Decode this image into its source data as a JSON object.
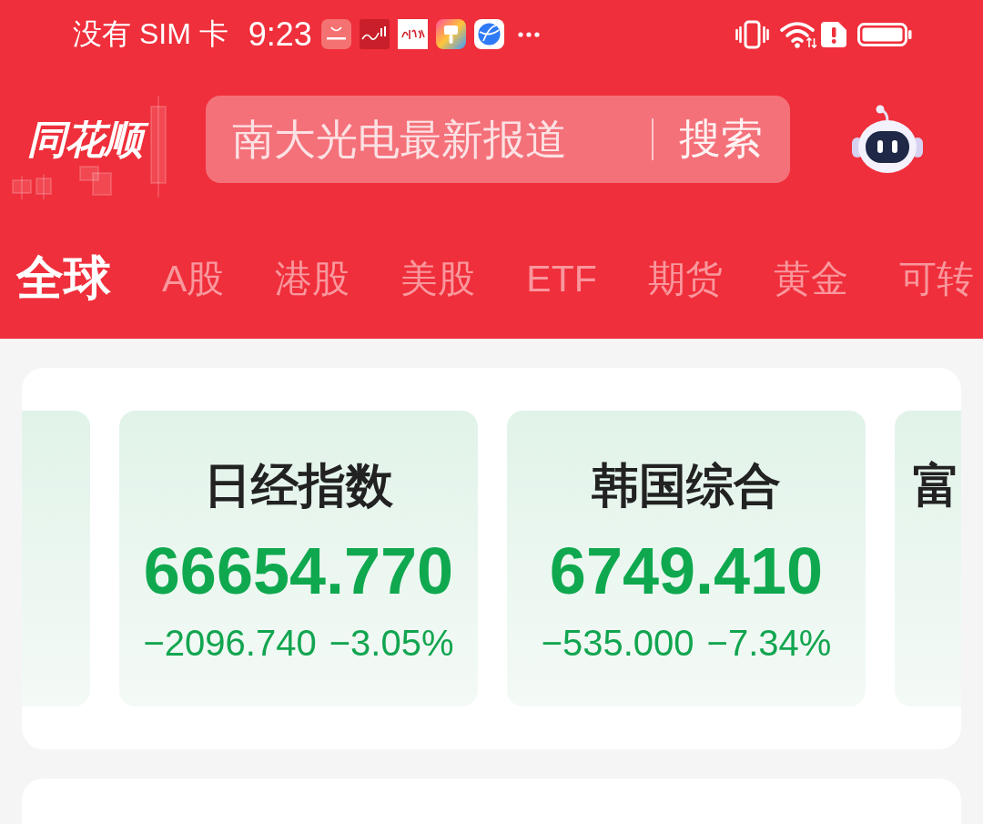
{
  "status_bar": {
    "carrier": "没有 SIM 卡",
    "time": "9:23"
  },
  "header": {
    "logo": "同花顺",
    "search": {
      "placeholder": "南大光电最新报道",
      "button": "搜索"
    }
  },
  "tabs": [
    {
      "label": "全球",
      "selected": true
    },
    {
      "label": "A股",
      "selected": false
    },
    {
      "label": "港股",
      "selected": false
    },
    {
      "label": "美股",
      "selected": false
    },
    {
      "label": "ETF",
      "selected": false
    },
    {
      "label": "期货",
      "selected": false
    },
    {
      "label": "黄金",
      "selected": false
    },
    {
      "label": "可转",
      "selected": false
    }
  ],
  "index_cards": [
    {
      "kind": "leading"
    },
    {
      "kind": "full",
      "name": "日经指数",
      "value": "66654.770",
      "change": "−2096.740",
      "percent": "−3.05%"
    },
    {
      "kind": "full",
      "name": "韩国综合",
      "value": "6749.410",
      "change": "−535.000",
      "percent": "−7.34%"
    },
    {
      "kind": "trailing",
      "name": "富"
    }
  ]
}
